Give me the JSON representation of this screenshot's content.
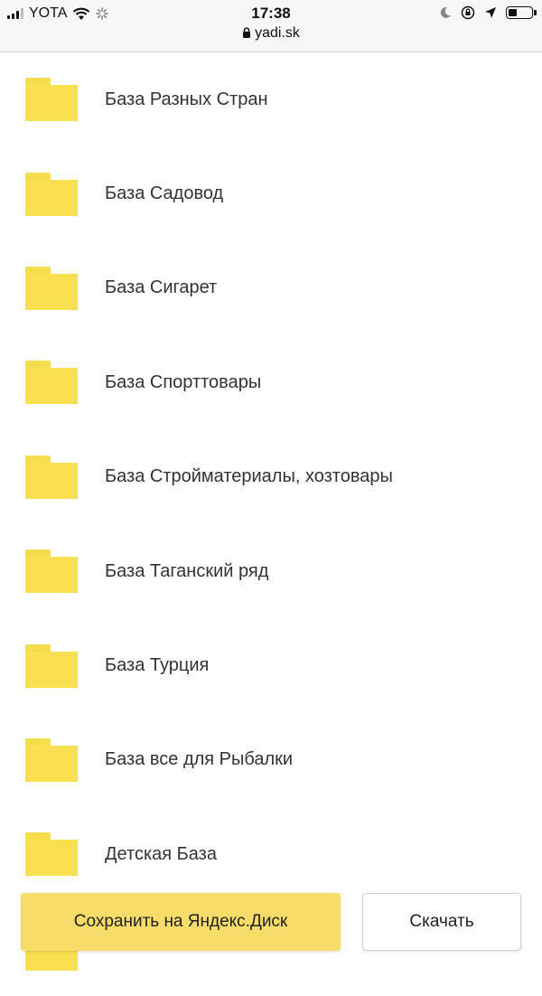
{
  "status_bar": {
    "carrier": "YOTA",
    "time": "17:38",
    "url": "yadi.sk",
    "battery_level": 0.35,
    "icons": [
      "signal-icon",
      "wifi-icon",
      "loading-icon",
      "lock-icon",
      "moon-icon",
      "orientation-lock-icon",
      "location-icon",
      "battery-icon"
    ]
  },
  "folders": [
    {
      "name": "База Разных Стран"
    },
    {
      "name": "База Садовод"
    },
    {
      "name": "База Сигарет"
    },
    {
      "name": "База Спорттовары"
    },
    {
      "name": "База Стройматериалы, хозтовары"
    },
    {
      "name": "База Таганский ряд"
    },
    {
      "name": "База Турция"
    },
    {
      "name": "База все для Рыбалки"
    },
    {
      "name": "Детская База"
    }
  ],
  "actions": {
    "save_label": "Сохранить на Яндекс.Диск",
    "download_label": "Скачать"
  },
  "colors": {
    "folder": "#fae050",
    "save_button": "#f7dc6a"
  }
}
